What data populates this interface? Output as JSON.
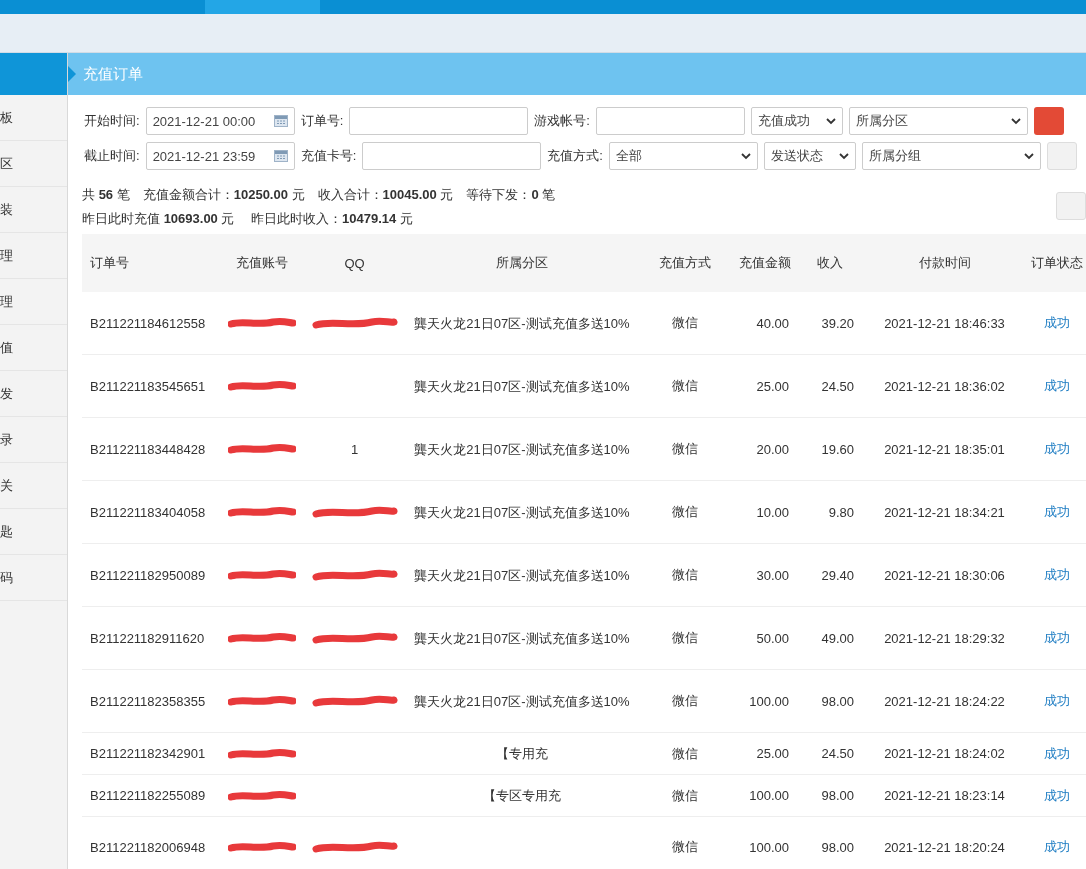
{
  "sidebar": {
    "items": [
      "板",
      "区",
      "装",
      "理",
      "理",
      "值",
      "发",
      "录",
      "关",
      "匙",
      "码"
    ]
  },
  "page_title": "充值订单",
  "filters": {
    "rows": [
      {
        "fields": [
          {
            "kind": "date",
            "label": "开始时间:",
            "value": "2021-12-21 00:00"
          },
          {
            "kind": "text",
            "label": "订单号:"
          },
          {
            "kind": "text",
            "label": "游戏帐号:"
          },
          {
            "kind": "select",
            "value": "充值成功"
          },
          {
            "kind": "select",
            "value": "所属分区"
          }
        ]
      },
      {
        "fields": [
          {
            "kind": "date",
            "label": "截止时间:",
            "value": "2021-12-21 23:59"
          },
          {
            "kind": "text",
            "label": "充值卡号:"
          },
          {
            "kind": "select",
            "label": "充值方式:",
            "value": "全部"
          },
          {
            "kind": "select",
            "value": "发送状态"
          },
          {
            "kind": "select",
            "value": "所属分组"
          }
        ]
      }
    ]
  },
  "summary": [
    {
      "text": "共 **56** 笔　充值金额合计：**10250.00** 元　收入合计：**10045.00** 元　等待下发：**0** 笔"
    },
    {
      "text": "昨日此时充值 **10693.00** 元　 昨日此时收入：**10479.14** 元"
    }
  ],
  "table": {
    "columns": [
      "订单号",
      "充值账号",
      "QQ",
      "所属分区",
      "充值方式",
      "充值金额",
      "收入",
      "付款时间",
      "订单状态"
    ],
    "rows": [
      {
        "order": "B211221184612558",
        "account_redacted": true,
        "qq_redacted": true,
        "zone": "龔天火龙21日07区-测试充值多送10%",
        "method": "微信",
        "amount": "40.00",
        "income": "39.20",
        "time": "2021-12-21 18:46:33",
        "status": "成功"
      },
      {
        "order": "B211221183545651",
        "account_redacted": true,
        "qq_redacted": false,
        "zone": "龔天火龙21日07区-测试充值多送10%",
        "method": "微信",
        "amount": "25.00",
        "income": "24.50",
        "time": "2021-12-21 18:36:02",
        "status": "成功"
      },
      {
        "order": "B211221183448428",
        "account_redacted": true,
        "qq_redacted": false,
        "qq": "1",
        "zone": "龔天火龙21日07区-测试充值多送10%",
        "method": "微信",
        "amount": "20.00",
        "income": "19.60",
        "time": "2021-12-21 18:35:01",
        "status": "成功"
      },
      {
        "order": "B211221183404058",
        "account_redacted": true,
        "qq_redacted": true,
        "zone": "龔天火龙21日07区-测试充值多送10%",
        "method": "微信",
        "amount": "10.00",
        "income": "9.80",
        "time": "2021-12-21 18:34:21",
        "status": "成功"
      },
      {
        "order": "B211221182950089",
        "account_redacted": true,
        "qq_redacted": true,
        "zone": "龔天火龙21日07区-测试充值多送10%",
        "method": "微信",
        "amount": "30.00",
        "income": "29.40",
        "time": "2021-12-21 18:30:06",
        "status": "成功"
      },
      {
        "order": "B211221182911620",
        "account_redacted": true,
        "qq_redacted": true,
        "zone": "龔天火龙21日07区-测试充值多送10%",
        "method": "微信",
        "amount": "50.00",
        "income": "49.00",
        "time": "2021-12-21 18:29:32",
        "status": "成功"
      },
      {
        "order": "B211221182358355",
        "account_redacted": true,
        "qq_redacted": true,
        "zone": "龔天火龙21日07区-测试充值多送10%",
        "method": "微信",
        "amount": "100.00",
        "income": "98.00",
        "time": "2021-12-21 18:24:22",
        "status": "成功"
      },
      {
        "order": "B211221182342901",
        "account_redacted": true,
        "qq_redacted": false,
        "zone": "【专用充",
        "method": "微信",
        "amount": "25.00",
        "income": "24.50",
        "time": "2021-12-21 18:24:02",
        "status": "成功"
      },
      {
        "order": "B211221182255089",
        "account_redacted": true,
        "qq_redacted": false,
        "zone": "【专区专用充",
        "method": "微信",
        "amount": "100.00",
        "income": "98.00",
        "time": "2021-12-21 18:23:14",
        "status": "成功"
      },
      {
        "order": "B211221182006948",
        "account_redacted": true,
        "qq_redacted": true,
        "method": "微信",
        "amount": "100.00",
        "income": "98.00",
        "time": "2021-12-21 18:20:24",
        "status": "成功"
      }
    ]
  }
}
